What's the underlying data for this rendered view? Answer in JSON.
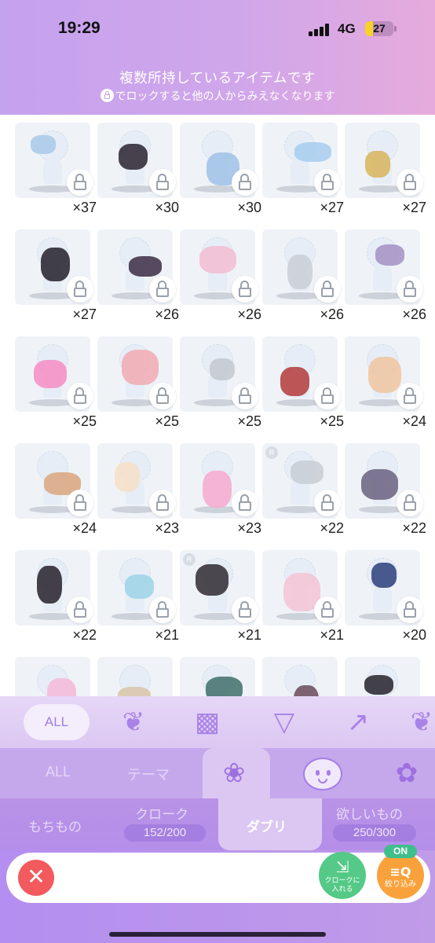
{
  "status": {
    "time": "19:29",
    "network": "4G",
    "battery": "27",
    "battery_level": 0.27
  },
  "notice": {
    "line1": "複数所持しているアイテムです",
    "line2": "でロックすると他の人からみえなくなります"
  },
  "items": [
    {
      "count": "×37",
      "icon": "blue-bow-hair-accessory",
      "color": "#a8c8e8"
    },
    {
      "count": "×30",
      "icon": "black-gloves",
      "color": "#2a2230"
    },
    {
      "count": "×30",
      "icon": "crystal-bell-wand",
      "color": "#9fc1e6"
    },
    {
      "count": "×27",
      "icon": "gift-boxes",
      "color": "#a7cbee"
    },
    {
      "count": "×27",
      "icon": "golden-star-wand",
      "color": "#d7b45a"
    },
    {
      "count": "×27",
      "icon": "black-choker",
      "color": "#22202a"
    },
    {
      "count": "×26",
      "icon": "black-lace-outfit",
      "color": "#3a2c44"
    },
    {
      "count": "×26",
      "icon": "pink-blue-dress",
      "color": "#f2bcd2"
    },
    {
      "count": "×26",
      "icon": "small-earrings",
      "color": "#c9ced6"
    },
    {
      "count": "×26",
      "icon": "lavender-hair-doll",
      "color": "#a38fc4"
    },
    {
      "count": "×25",
      "icon": "pink-heart-balloons",
      "color": "#f68cc4"
    },
    {
      "count": "×25",
      "icon": "pink-bear-plush",
      "color": "#f1a9b3"
    },
    {
      "count": "×25",
      "icon": "small-charm",
      "color": "#c3c7cf"
    },
    {
      "count": "×25",
      "icon": "red-heels",
      "color": "#b33a3a"
    },
    {
      "count": "×24",
      "icon": "peach-pearl-veil",
      "color": "#f0c4a0"
    },
    {
      "count": "×24",
      "icon": "copper-bracelets",
      "color": "#d9a57e"
    },
    {
      "count": "×23",
      "icon": "cream-stockings",
      "color": "#f6dfc7"
    },
    {
      "count": "×23",
      "icon": "pink-love-letter",
      "color": "#f7a8cf"
    },
    {
      "count": "×22",
      "icon": "silver-tiara",
      "color": "#c7ccd4",
      "badge": "R"
    },
    {
      "count": "×22",
      "icon": "lantern-staff",
      "color": "#6a6080"
    },
    {
      "count": "×22",
      "icon": "black-bow-necklace",
      "color": "#24202a"
    },
    {
      "count": "×21",
      "icon": "pastel-ribbon-scarf",
      "color": "#9cd2e8"
    },
    {
      "count": "×21",
      "icon": "black-feather-fan",
      "color": "#2e2a30",
      "badge": "R"
    },
    {
      "count": "×21",
      "icon": "pink-heart-frame",
      "color": "#f3c3d5"
    },
    {
      "count": "×20",
      "icon": "navy-bow-shoes",
      "color": "#2b3e7a"
    },
    {
      "count": "",
      "icon": "pink-frill-socks",
      "color": "#f4b7d8"
    },
    {
      "count": "",
      "icon": "beige-plush-pillow",
      "color": "#d8c3a8"
    },
    {
      "count": "",
      "icon": "green-pipa-instrument",
      "color": "#3f6d6a"
    },
    {
      "count": "",
      "icon": "dark-rose-wreath",
      "color": "#6a4a5a"
    },
    {
      "count": "",
      "icon": "black-boots",
      "color": "#24212a"
    }
  ],
  "category_bar": {
    "all_label": "ALL",
    "icons": [
      "dress-icon",
      "top-shirt-icon",
      "skirt-icon",
      "heel-shoe-icon"
    ]
  },
  "sub_bar": {
    "all_label": "ALL",
    "theme_label": "テーマ",
    "icons": [
      "hair-icon",
      "face-icon",
      "plant-pot-icon"
    ]
  },
  "tabs": {
    "mochimono": "もちもの",
    "cloak": "クローク",
    "cloak_count": "152/200",
    "daburi": "ダブリ",
    "wishlist": "欲しいもの",
    "wishlist_count": "250/300"
  },
  "bottom": {
    "clear_icon": "close-icon",
    "cloak_button": "クロークに\n入れる",
    "filter_on": "ON",
    "filter_label": "絞り込み",
    "filter_glyph": "≡Q"
  },
  "colors": {
    "accent": "#a47ee6",
    "clear": "#f25a5e",
    "green": "#55c987",
    "orange": "#f9a23b"
  }
}
